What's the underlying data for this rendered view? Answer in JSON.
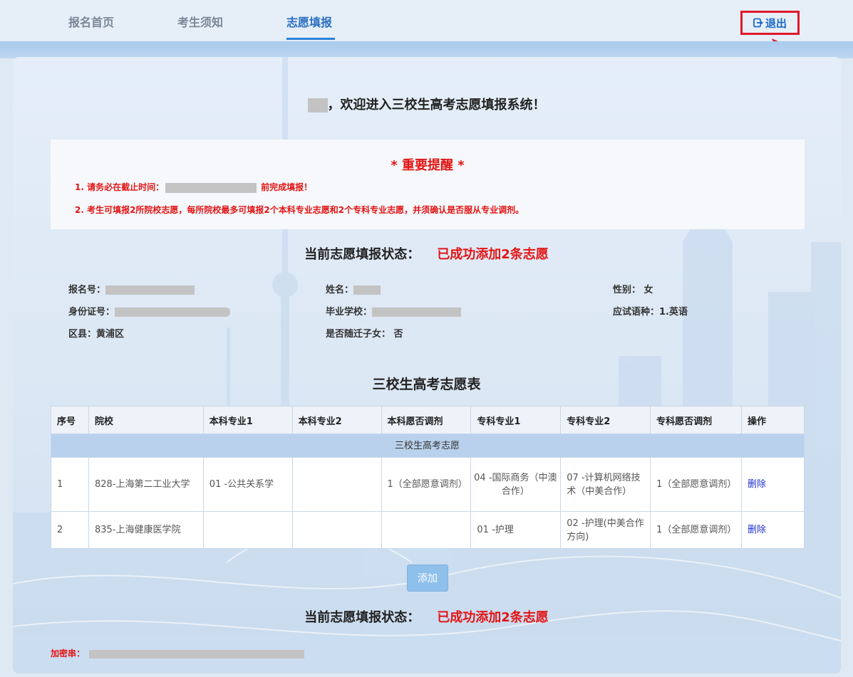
{
  "nav": {
    "items": [
      {
        "label": "报名首页"
      },
      {
        "label": "考生须知"
      },
      {
        "label": "志愿填报"
      }
    ],
    "logout_label": "退出"
  },
  "welcome": {
    "text": "，欢迎进入三校生高考志愿填报系统！"
  },
  "notice": {
    "title": "* 重要提醒 *",
    "line1_prefix": "1. 请务必在截止时间：",
    "line1_suffix": "前完成填报！",
    "line2": "2. 考生可填报2所院校志愿，每所院校最多可填报2个本科专业志愿和2个专科专业志愿，并须确认是否服从专业调剂。"
  },
  "status": {
    "label": "当前志愿填报状态：",
    "value": "已成功添加2条志愿"
  },
  "info": {
    "reg_label": "报名号：",
    "name_label": "姓名：",
    "gender": "性别：  女",
    "id_label": "身份证号：",
    "school_label": "毕业学校：",
    "lang": "应试语种：1.英语",
    "district": "区县：黄浦区",
    "migrant": "是否随迁子女： 否"
  },
  "table": {
    "title": "三校生高考志愿表",
    "headers": [
      "序号",
      "院校",
      "本科专业1",
      "本科专业2",
      "本科愿否调剂",
      "专科专业1",
      "专科专业2",
      "专科愿否调剂",
      "操作"
    ],
    "group_label": "三校生高考志愿",
    "rows": [
      {
        "no": "1",
        "school": "828-上海第二工业大学",
        "b1": "01 -公共关系学",
        "b2": "",
        "badj": "1（全部愿意调剂）",
        "z1": "04 -国际商务（中澳合作）",
        "z2": "07 -计算机网络技术（中美合作）",
        "zadj": "1（全部愿意调剂）",
        "op": "删除"
      },
      {
        "no": "2",
        "school": "835-上海健康医学院",
        "b1": "",
        "b2": "",
        "badj": "",
        "z1": "01 -护理",
        "z2": "02 -护理(中美合作方向)",
        "zadj": "1（全部愿意调剂）",
        "op": "删除"
      }
    ]
  },
  "add_label": "添加",
  "secret_label": "加密串："
}
